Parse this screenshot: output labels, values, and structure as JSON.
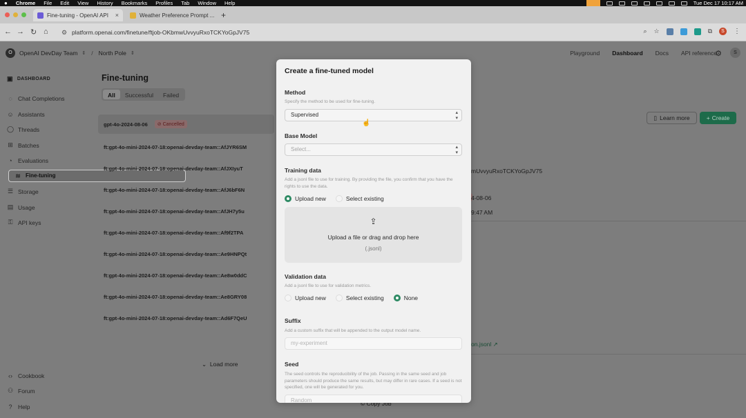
{
  "menubar": {
    "apple": "",
    "items": [
      "Chrome",
      "File",
      "Edit",
      "View",
      "History",
      "Bookmarks",
      "Profiles",
      "Tab",
      "Window",
      "Help"
    ],
    "clock": "Tue Dec 17  10:17 AM"
  },
  "tabs": [
    {
      "title": "Fine-tuning - OpenAI API",
      "active": true,
      "color": "#6b5bd6"
    },
    {
      "title": "Weather Preference Prompt ...",
      "active": false,
      "color": "#e0b13a"
    }
  ],
  "address": {
    "url": "platform.openai.com/finetune/ftjob-OKbmwUvvyuRxoTCKYoGpJV75"
  },
  "topnav": {
    "org_initial": "O",
    "org": "OpenAI DevDay Team",
    "project": "North Pole",
    "links": [
      "Playground",
      "Dashboard",
      "Docs",
      "API reference"
    ],
    "current": "Dashboard",
    "user_initial": "S"
  },
  "sidebar": {
    "title": "DASHBOARD",
    "items": [
      {
        "label": "Chat Completions",
        "icon": "chat-icon"
      },
      {
        "label": "Assistants",
        "icon": "assistant-icon"
      },
      {
        "label": "Threads",
        "icon": "threads-icon"
      },
      {
        "label": "Batches",
        "icon": "batches-icon"
      },
      {
        "label": "Evaluations",
        "icon": "evaluations-icon"
      },
      {
        "label": "Fine-tuning",
        "icon": "fine-tuning-icon",
        "selected": true
      },
      {
        "label": "Storage",
        "icon": "storage-icon"
      },
      {
        "label": "Usage",
        "icon": "usage-icon"
      },
      {
        "label": "API keys",
        "icon": "key-icon"
      }
    ],
    "bottom": [
      {
        "label": "Cookbook",
        "icon": "code-icon"
      },
      {
        "label": "Forum",
        "icon": "forum-icon"
      },
      {
        "label": "Help",
        "icon": "help-icon"
      }
    ]
  },
  "main": {
    "title": "Fine-tuning",
    "filters": [
      "All",
      "Successful",
      "Failed"
    ],
    "active_filter": "All",
    "jobs": [
      {
        "name": "gpt-4o-2024-08-06",
        "status": "Cancelled"
      },
      {
        "name": "ft:gpt-4o-mini-2024-07-18:openai-devday-team::AfJYR6SM"
      },
      {
        "name": "ft:gpt-4o-mini-2024-07-18:openai-devday-team::AfJXIyuT"
      },
      {
        "name": "ft:gpt-4o-mini-2024-07-18:openai-devday-team::AfJ6bF6N"
      },
      {
        "name": "ft:gpt-4o-mini-2024-07-18:openai-devday-team::AfJH7y5u"
      },
      {
        "name": "ft:gpt-4o-mini-2024-07-18:openai-devday-team::Af9f2TPA"
      },
      {
        "name": "ft:gpt-4o-mini-2024-07-18:openai-devday-team::Ae9HNPQt"
      },
      {
        "name": "ft:gpt-4o-mini-2024-07-18:openai-devday-team::Ae8w0ddC"
      },
      {
        "name": "ft:gpt-4o-mini-2024-07-18:openai-devday-team::Ae8GRY08"
      },
      {
        "name": "ft:gpt-4o-mini-2024-07-18:openai-devday-team::Ad6F7QeU"
      }
    ],
    "load_more": "Load more",
    "learn_more": "Learn more",
    "create": "Create",
    "details": {
      "job_id_fragment": "mUvvyuRxoTCKYoGpJV75",
      "date_fragment": "4-08-06",
      "time_fragment": "9:47 AM",
      "file_fragment": "on.jsonl ↗",
      "copy_job": "Copy Job"
    }
  },
  "modal": {
    "title": "Create a fine-tuned model",
    "method": {
      "label": "Method",
      "help": "Specify the method to be used for fine-tuning.",
      "value": "Supervised"
    },
    "base_model": {
      "label": "Base Model",
      "placeholder": "Select..."
    },
    "training": {
      "label": "Training data",
      "help": "Add a jsonl file to use for training. By providing the file, you confirm that you have the rights to use the data.",
      "options": [
        "Upload new",
        "Select existing"
      ],
      "selected": "Upload new",
      "drop_text": "Upload a file or drag and drop here",
      "drop_ext": "(.jsonl)"
    },
    "validation": {
      "label": "Validation data",
      "help": "Add a jsonl file to use for validation metrics.",
      "options": [
        "Upload new",
        "Select existing",
        "None"
      ],
      "selected": "None"
    },
    "suffix": {
      "label": "Suffix",
      "help": "Add a custom suffix that will be appended to the output model name.",
      "placeholder": "my-experiment"
    },
    "seed": {
      "label": "Seed",
      "help": "The seed controls the reproducibility of the job. Passing in the same seed and job parameters should produce the same results, but may differ in rare cases. If a seed is not specified, one will be generated for you.",
      "placeholder": "Random"
    }
  },
  "colors": {
    "accent_green": "#2d8a63",
    "create_button": "#1d6b4a",
    "overlay": "#7d7d7d"
  }
}
